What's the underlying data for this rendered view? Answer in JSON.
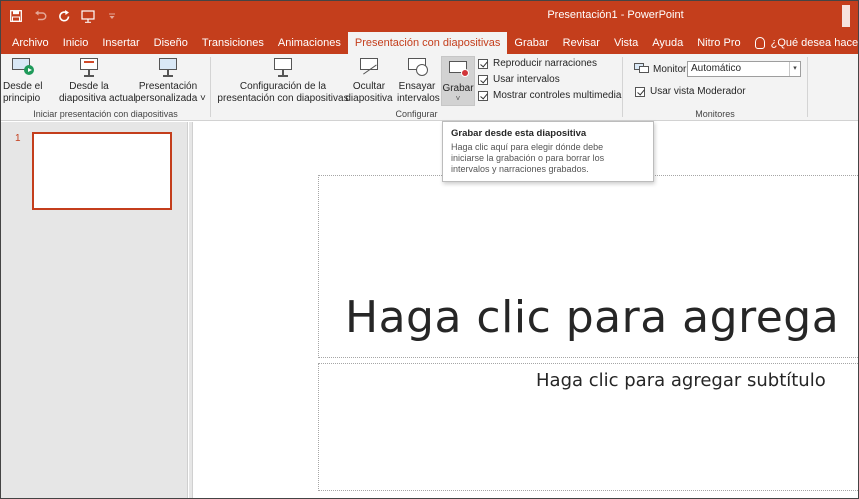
{
  "title_bar": {
    "app_title": "Presentación1 - PowerPoint",
    "qat": {
      "save_icon": "save-icon",
      "undo_icon": "undo-icon",
      "redo_icon": "redo-icon",
      "present_icon": "present-from-start-icon"
    }
  },
  "tabs": [
    {
      "label": "Archivo",
      "active": false
    },
    {
      "label": "Inicio",
      "active": false
    },
    {
      "label": "Insertar",
      "active": false
    },
    {
      "label": "Diseño",
      "active": false
    },
    {
      "label": "Transiciones",
      "active": false
    },
    {
      "label": "Animaciones",
      "active": false
    },
    {
      "label": "Presentación con diapositivas",
      "active": true
    },
    {
      "label": "Grabar",
      "active": false
    },
    {
      "label": "Revisar",
      "active": false
    },
    {
      "label": "Vista",
      "active": false
    },
    {
      "label": "Ayuda",
      "active": false
    },
    {
      "label": "Nitro Pro",
      "active": false
    },
    {
      "label": "¿Qué desea hacer?",
      "active": false
    }
  ],
  "ribbon": {
    "start": {
      "from_beginning": [
        "Desde el",
        "principio"
      ],
      "from_current": [
        "Desde la",
        "diapositiva actual"
      ],
      "custom": [
        "Presentación",
        "personalizada ˅"
      ],
      "label": "Iniciar presentación con diapositivas"
    },
    "setup": {
      "configure": [
        "Configuración de la",
        "presentación con diapositivas"
      ],
      "hide": [
        "Ocultar",
        "diapositiva"
      ],
      "rehearse": [
        "Ensayar",
        "intervalos"
      ],
      "record": "Grabar",
      "record_chevron": "˅",
      "label": "Configurar",
      "checks": [
        {
          "label": "Reproducir narraciones",
          "checked": true
        },
        {
          "label": "Usar intervalos",
          "checked": true
        },
        {
          "label": "Mostrar controles multimedia",
          "checked": true
        }
      ]
    },
    "monitors": {
      "monitor_label": "Monitor:",
      "monitor_value": "Automático",
      "presenter_view": {
        "label": "Usar vista Moderador",
        "checked": true
      },
      "label": "Monitores"
    }
  },
  "tooltip": {
    "title": "Grabar desde esta diapositiva",
    "body": [
      "Haga clic aquí para elegir dónde debe",
      "iniciarse la grabación o para borrar los",
      "intervalos y narraciones grabados."
    ]
  },
  "thumbnails": {
    "number": "1"
  },
  "slide": {
    "title_placeholder": "Haga clic para agrega",
    "subtitle_placeholder": "Haga clic para agregar subtítulo"
  },
  "colors": {
    "accent": "#c43e1c",
    "ribbon_bg": "#f3f3f3",
    "pane_bg": "#e6e6e6"
  }
}
